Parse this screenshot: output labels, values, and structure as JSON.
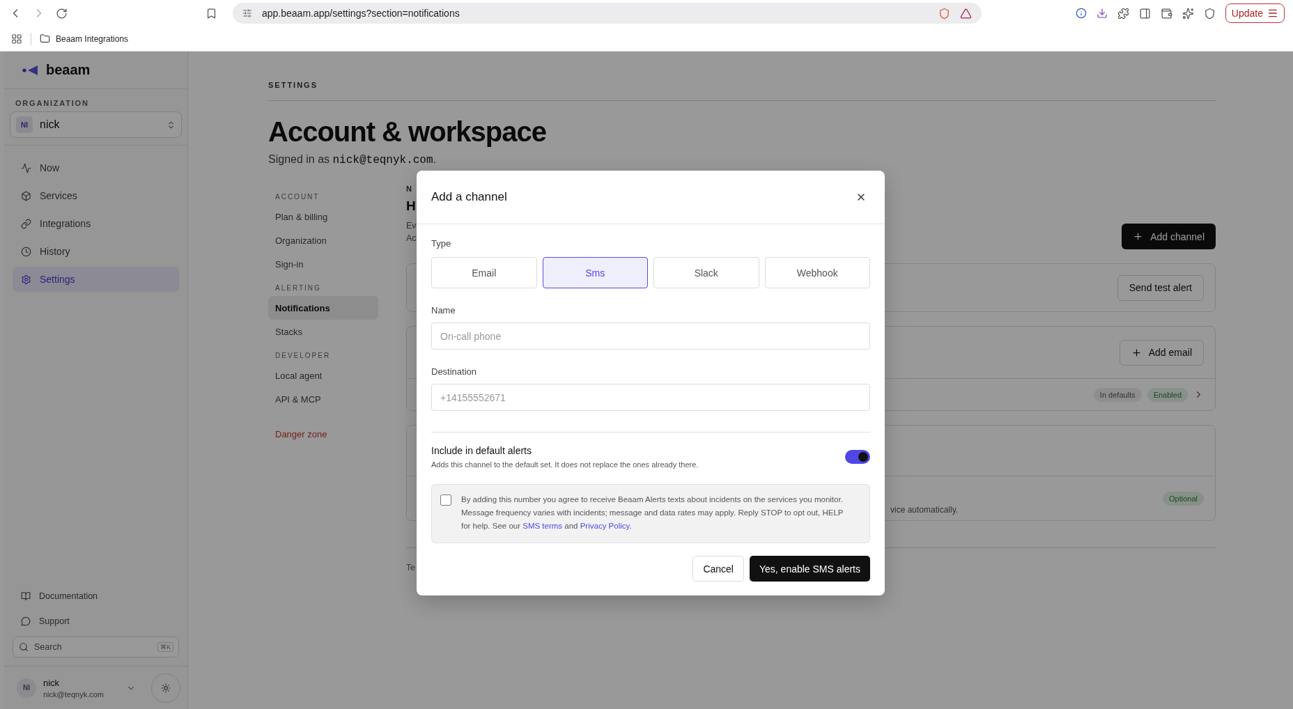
{
  "browser": {
    "url": "app.beaam.app/settings?section=notifications",
    "bookmark": "Beaam Integrations",
    "update_button": "Update"
  },
  "sidebar": {
    "brand": "beaam",
    "org_heading": "ORGANIZATION",
    "org": {
      "initials": "NI",
      "name": "nick"
    },
    "nav": [
      {
        "label": "Now",
        "selected": false
      },
      {
        "label": "Services",
        "selected": false
      },
      {
        "label": "Integrations",
        "selected": false
      },
      {
        "label": "History",
        "selected": false
      },
      {
        "label": "Settings",
        "selected": true
      }
    ],
    "footer_links": [
      {
        "label": "Documentation"
      },
      {
        "label": "Support"
      }
    ],
    "search": {
      "placeholder": "Search",
      "shortcut": "⌘K"
    },
    "user": {
      "initials": "NI",
      "name": "nick",
      "email": "nick@teqnyk.com"
    }
  },
  "page": {
    "eyebrow": "SETTINGS",
    "title": "Account & workspace",
    "signed_in_prefix": "Signed in as ",
    "signed_in_email": "nick@teqnyk.com",
    "signed_in_suffix": ".",
    "subnav": [
      {
        "heading": "ACCOUNT",
        "items": [
          {
            "label": "Plan & billing",
            "selected": false
          },
          {
            "label": "Organization",
            "selected": false
          },
          {
            "label": "Sign-in",
            "selected": false
          }
        ]
      },
      {
        "heading": "ALERTING",
        "items": [
          {
            "label": "Notifications",
            "selected": true
          },
          {
            "label": "Stacks",
            "selected": false
          }
        ]
      },
      {
        "heading": "DEVELOPER",
        "items": [
          {
            "label": "Local agent",
            "selected": false
          },
          {
            "label": "API & MCP",
            "selected": false
          }
        ]
      }
    ],
    "danger_link": "Danger zone",
    "content": {
      "section_label": "N",
      "heading": "H",
      "description_lines": [
        "Ev",
        "Ac"
      ],
      "add_channel_button": "Add channel",
      "test_card": {
        "button": "Send test alert"
      },
      "email_card": {
        "button": "Add email",
        "badges": [
          {
            "label": "In defaults",
            "kind": "neutral"
          },
          {
            "label": "Enabled",
            "kind": "success"
          }
        ]
      },
      "third_card": {
        "text": "vice automatically.",
        "badges": [
          {
            "label": "Optional",
            "kind": "success"
          }
        ]
      },
      "footer_text": "Te"
    }
  },
  "modal": {
    "title": "Add a channel",
    "type_label": "Type",
    "types": [
      {
        "label": "Email",
        "selected": false
      },
      {
        "label": "Sms",
        "selected": true
      },
      {
        "label": "Slack",
        "selected": false
      },
      {
        "label": "Webhook",
        "selected": false
      }
    ],
    "name_field": {
      "label": "Name",
      "placeholder": "On-call phone"
    },
    "destination_field": {
      "label": "Destination",
      "placeholder": "+14155552671"
    },
    "default_alerts": {
      "title": "Include in default alerts",
      "description": "Adds this channel to the default set. It does not replace the ones already there.",
      "on": true
    },
    "consent": {
      "checked": false,
      "parts": [
        {
          "kind": "text",
          "text": "By adding this number you agree to receive Beaam Alerts texts about incidents on the services you monitor. Message frequency varies with incidents; message and data rates may apply. Reply STOP to opt out, HELP for help. See our "
        },
        {
          "kind": "link",
          "text": "SMS terms"
        },
        {
          "kind": "text",
          "text": " and "
        },
        {
          "kind": "link",
          "text": "Privacy Policy"
        },
        {
          "kind": "text",
          "text": "."
        }
      ]
    },
    "cancel_button": "Cancel",
    "confirm_button": "Yes, enable SMS alerts"
  }
}
